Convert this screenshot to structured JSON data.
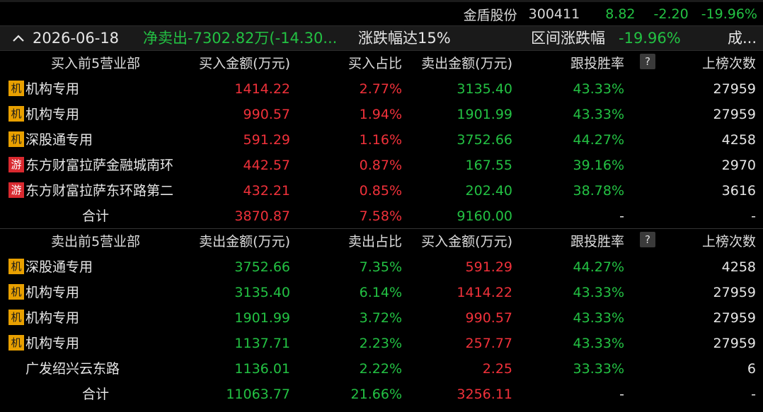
{
  "stock": {
    "name": "金盾股份",
    "code": "300411",
    "price": "8.82",
    "change": "-2.20",
    "change_pct": "-19.96%"
  },
  "header": {
    "date": "2026-06-18",
    "net": "净卖出-7302.82万(-14.30...",
    "reason": "涨跌幅达15%",
    "range_label": "区间涨跌幅",
    "range_value": "-19.96%",
    "more": "成..."
  },
  "buy_section": {
    "headers": [
      "买入前5营业部",
      "买入金额(万元)",
      "买入占比",
      "卖出金额(万元)",
      "跟投胜率",
      "上榜次数"
    ],
    "help": "?",
    "rows": [
      {
        "badge": "机",
        "badge_type": "ji",
        "name": "机构专用",
        "amount": "1414.22",
        "pct": "2.77%",
        "other": "3135.40",
        "win": "43.33%",
        "count": "27959"
      },
      {
        "badge": "机",
        "badge_type": "ji",
        "name": "机构专用",
        "amount": "990.57",
        "pct": "1.94%",
        "other": "1901.99",
        "win": "43.33%",
        "count": "27959"
      },
      {
        "badge": "机",
        "badge_type": "ji",
        "name": "深股通专用",
        "amount": "591.29",
        "pct": "1.16%",
        "other": "3752.66",
        "win": "44.27%",
        "count": "4258"
      },
      {
        "badge": "游",
        "badge_type": "you",
        "name": "东方财富拉萨金融城南环",
        "amount": "442.57",
        "pct": "0.87%",
        "other": "167.55",
        "win": "39.16%",
        "count": "2970"
      },
      {
        "badge": "游",
        "badge_type": "you",
        "name": "东方财富拉萨东环路第二",
        "amount": "432.21",
        "pct": "0.85%",
        "other": "202.40",
        "win": "38.78%",
        "count": "3616"
      }
    ],
    "total": {
      "label": "合计",
      "amount": "3870.87",
      "pct": "7.58%",
      "other": "9160.00",
      "win": "-",
      "count": "-"
    }
  },
  "sell_section": {
    "headers": [
      "卖出前5营业部",
      "卖出金额(万元)",
      "卖出占比",
      "买入金额(万元)",
      "跟投胜率",
      "上榜次数"
    ],
    "help": "?",
    "rows": [
      {
        "badge": "机",
        "badge_type": "ji",
        "name": "深股通专用",
        "amount": "3752.66",
        "pct": "7.35%",
        "other": "591.29",
        "win": "44.27%",
        "count": "4258"
      },
      {
        "badge": "机",
        "badge_type": "ji",
        "name": "机构专用",
        "amount": "3135.40",
        "pct": "6.14%",
        "other": "1414.22",
        "win": "43.33%",
        "count": "27959"
      },
      {
        "badge": "机",
        "badge_type": "ji",
        "name": "机构专用",
        "amount": "1901.99",
        "pct": "3.72%",
        "other": "990.57",
        "win": "43.33%",
        "count": "27959"
      },
      {
        "badge": "机",
        "badge_type": "ji",
        "name": "机构专用",
        "amount": "1137.71",
        "pct": "2.23%",
        "other": "257.77",
        "win": "43.33%",
        "count": "27959"
      },
      {
        "badge": "",
        "badge_type": "none",
        "name": "广发绍兴云东路",
        "amount": "1136.01",
        "pct": "2.22%",
        "other": "2.25",
        "win": "33.33%",
        "count": "6"
      }
    ],
    "total": {
      "label": "合计",
      "amount": "11063.77",
      "pct": "21.66%",
      "other": "3256.11",
      "win": "-",
      "count": "-"
    }
  },
  "colors": {
    "up": "#f0313a",
    "down": "#23c143",
    "badge_ji": "#e8a000",
    "badge_you": "#d9292f"
  }
}
